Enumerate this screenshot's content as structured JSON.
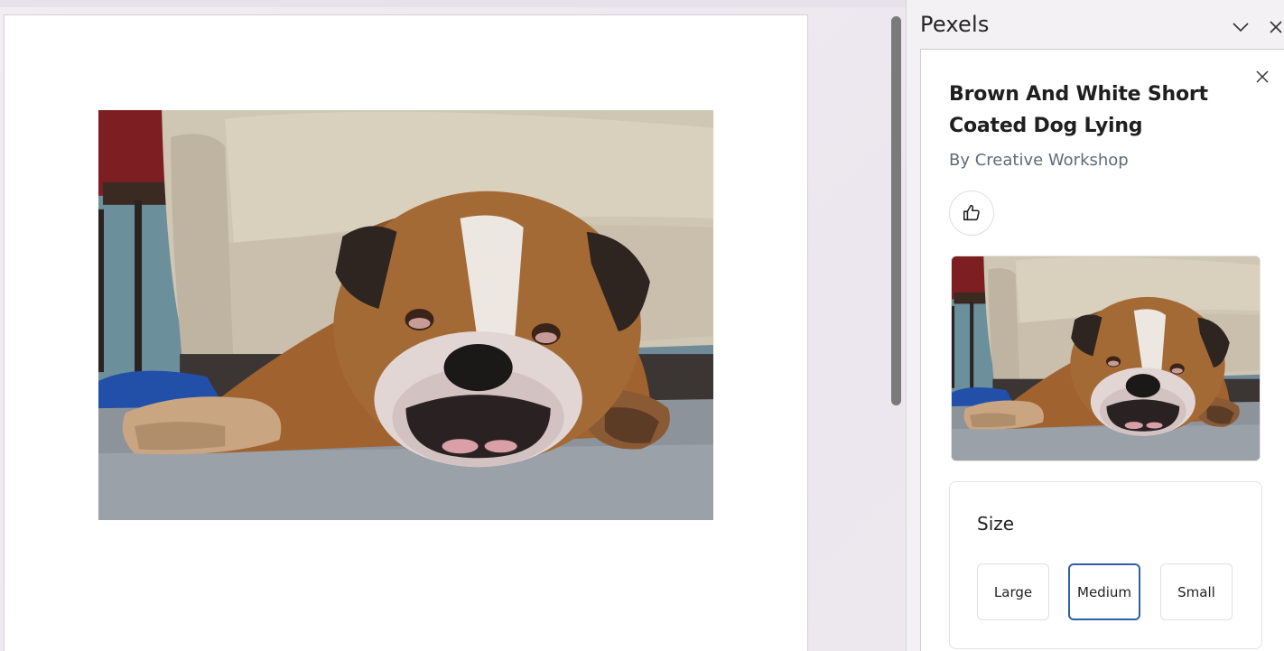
{
  "pane": {
    "title": "Pexels",
    "chevron_icon": "chevron-down-icon",
    "close_icon": "close-icon"
  },
  "photo": {
    "title": "Brown And White Short Coated Dog Lying",
    "author": "By Creative Workshop",
    "like_icon": "thumbs-up-icon"
  },
  "size": {
    "label": "Size",
    "options": [
      {
        "label": "Large",
        "selected": false
      },
      {
        "label": "Medium",
        "selected": true
      },
      {
        "label": "Small",
        "selected": false
      }
    ]
  },
  "colors": {
    "accent": "#2f5fa8",
    "author_text": "#5f6b7a"
  }
}
